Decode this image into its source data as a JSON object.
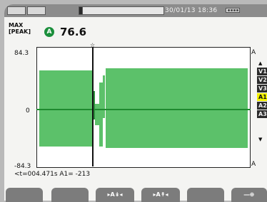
{
  "status": {
    "datetime": "30/01/13  18:36"
  },
  "measure": {
    "mode_line1": "MAX",
    "mode_line2": "[PEAK]",
    "channel_badge": "A",
    "value": "76.6"
  },
  "axis": {
    "top": "84.3",
    "zero": "0",
    "bottom": "-84.3",
    "right_top": "A",
    "right_bottom": "A"
  },
  "cursor": {
    "readout": "<t=004.471s A1= -213",
    "marker": "☆"
  },
  "channels": [
    "V1",
    "V2",
    "V3",
    "A1",
    "A2",
    "A3"
  ],
  "selected_channel": "A1",
  "function_keys": [
    {
      "label": ""
    },
    {
      "label": ""
    },
    {
      "label": "▸A↡◂"
    },
    {
      "label": "▸A↟◂"
    },
    {
      "label": ""
    },
    {
      "label": "―⊕"
    }
  ],
  "colors": {
    "waveform": "#5cc16a",
    "zero_line": "#1f8a2f",
    "active_channel": "#f2f000",
    "badge": "#1b8f3c"
  }
}
